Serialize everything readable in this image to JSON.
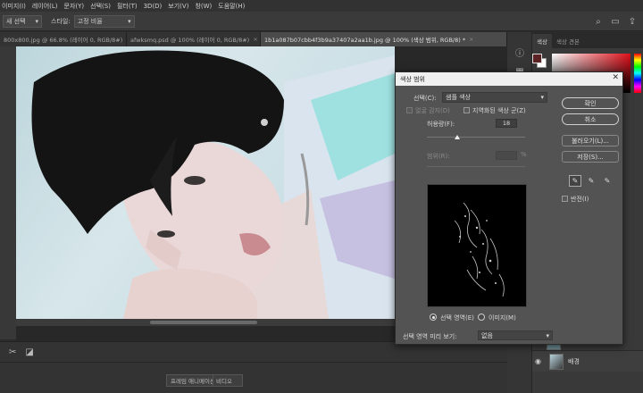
{
  "menu": [
    "이미지(I)",
    "레이어(L)",
    "문자(Y)",
    "선택(S)",
    "필터(T)",
    "3D(D)",
    "보기(V)",
    "창(W)",
    "도움말(H)"
  ],
  "options": {
    "tool_select": "새 선택",
    "style_label": "스타일:",
    "style_value": "고정 비율"
  },
  "tabs": [
    {
      "label": "800x800.jpg @ 66.8% (레이어 0, RGB/8#)",
      "active": false
    },
    {
      "label": "afwksmq.psd @ 100% (레이어 0, RGB/8#)",
      "active": false
    },
    {
      "label": "1b1a087b07cbb4f3b9a37407a2aa1b.jpg @ 100% (색상 범위, RGB/8) *",
      "active": true
    }
  ],
  "side_panel": {
    "tabs": [
      "색상",
      "색상 견본"
    ],
    "layer_name": "배경"
  },
  "timeline": {
    "create_button": "프레임 애니메이션 만들기",
    "dropdown": "비디오"
  },
  "dialog": {
    "title": "색상 범위",
    "select_label": "선택(C):",
    "select_value": "샘플 색상",
    "detect_faces": "얼굴 감지(D)",
    "localized": "지역화된 색상 군(Z)",
    "fuzziness_label": "허용량(F):",
    "fuzziness_value": "18",
    "range_label": "범위(R):",
    "range_pct": "%",
    "selection_label": "선택 영역(E)",
    "image_label": "이미지(M)",
    "preview_label": "선택 영역 미리 보기:",
    "preview_value": "없음",
    "ok": "확인",
    "cancel": "취소",
    "load": "불러오기(L)...",
    "save": "저장(S)...",
    "invert": "반전(I)"
  }
}
